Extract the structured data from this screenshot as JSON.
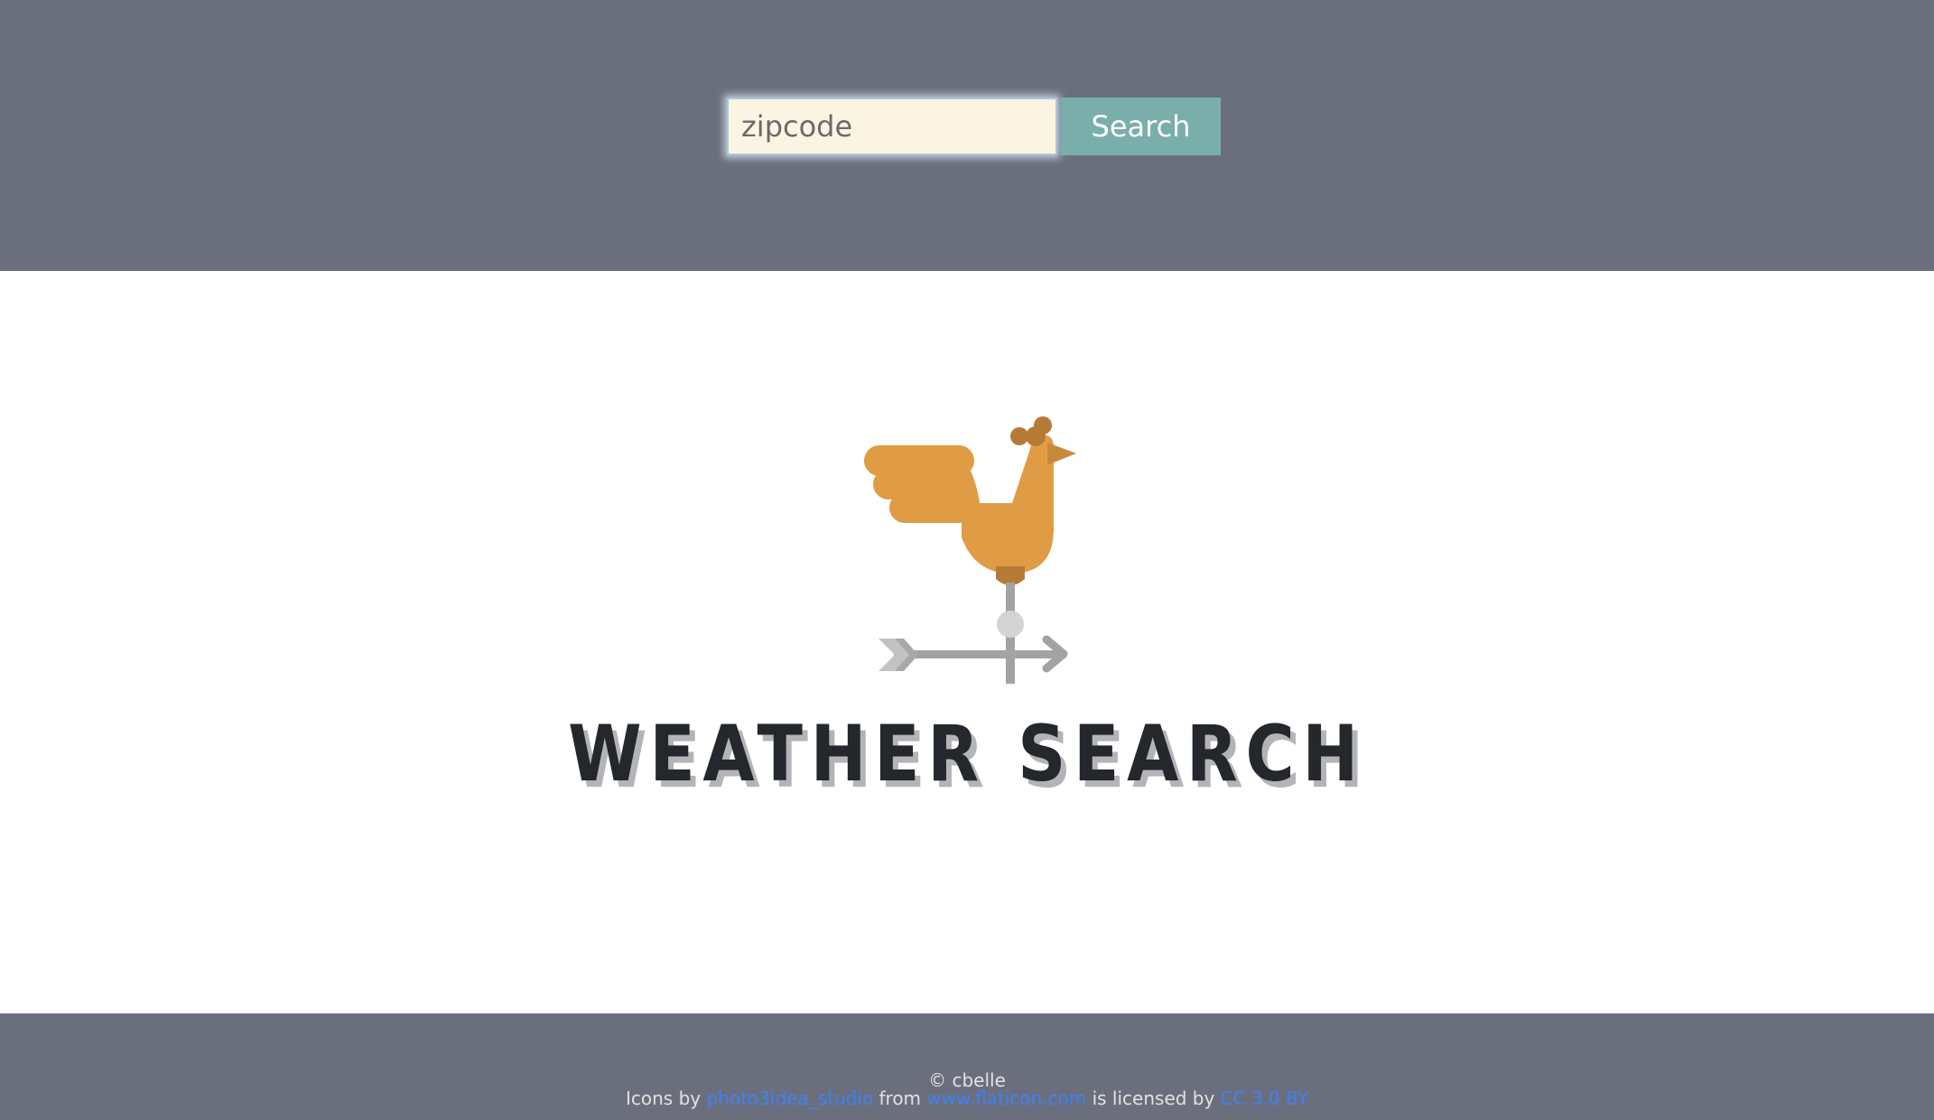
{
  "search": {
    "placeholder": "zipcode",
    "value": "",
    "button_label": "Search"
  },
  "hero": {
    "logo_icon": "weathervane-rooster-icon",
    "title": "WEATHER SEARCH"
  },
  "footer": {
    "copyright": "© cbelle",
    "credits": {
      "prefix": "Icons by",
      "author": "photo3idea_studio",
      "from_text": "from",
      "site": "www.flaticon.com",
      "license_text": "is licensed by",
      "license": "CC 3.0 BY"
    }
  },
  "colors": {
    "header_bg": "#6b6f7d",
    "input_bg": "#fcf4e2",
    "button_bg": "#7aaeaa",
    "rooster": "#e09c45",
    "rooster_dark": "#b57a35",
    "vane_gray": "#a3a3a3",
    "title_text": "#24272c",
    "link": "#3b82f6"
  }
}
